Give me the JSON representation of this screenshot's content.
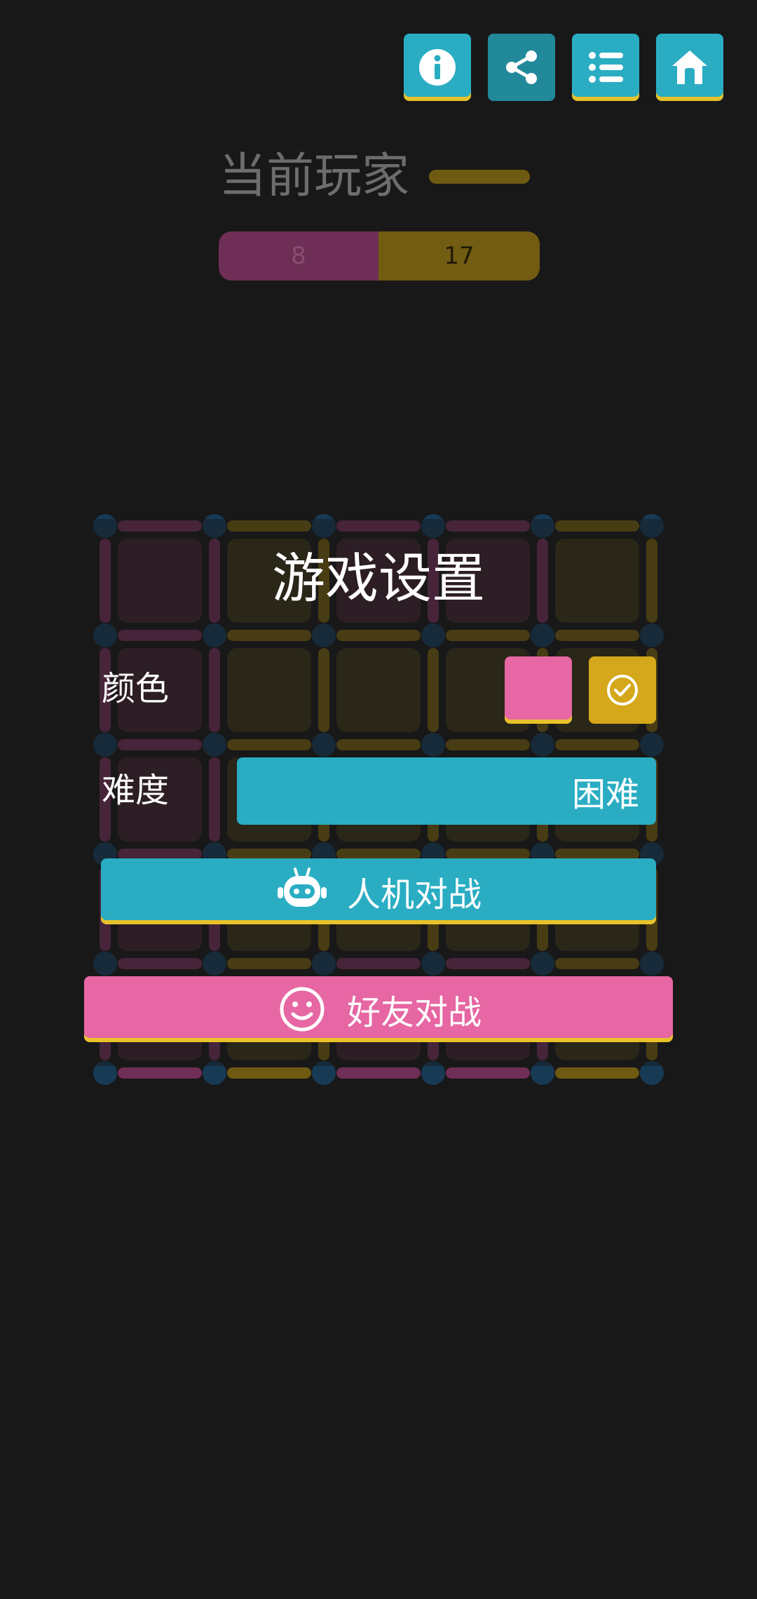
{
  "toolbar": {
    "buttons": [
      {
        "icon": "info-icon"
      },
      {
        "icon": "share-icon"
      },
      {
        "icon": "list-icon"
      },
      {
        "icon": "home-icon"
      }
    ]
  },
  "status": {
    "current_player_label": "当前玩家",
    "current_player_color": "#6f5a12",
    "score_pink": "8",
    "score_yellow": "17"
  },
  "board": {
    "cols": 5,
    "rows": 5,
    "cells": [
      [
        "pink",
        "yellow",
        "pink",
        "pink",
        "yellow"
      ],
      [
        "pink",
        "yellow",
        "yellow",
        "yellow",
        "yellow"
      ],
      [
        "pink",
        "yellow",
        "yellow",
        "yellow",
        "yellow"
      ],
      [
        "pink",
        "yellow",
        "yellow",
        "yellow",
        "yellow"
      ],
      [
        "pink",
        "yellow",
        "pink",
        "pink",
        "yellow"
      ]
    ],
    "colors": {
      "pink_cell": "#3f2330",
      "yellow_cell": "#3a3218",
      "pink_line": "#6e2e55",
      "yellow_line": "#6f5a12",
      "dot": "#173a55"
    }
  },
  "dialog": {
    "title": "游戏设置",
    "color_label": "颜色",
    "difficulty_label": "难度",
    "difficulty_value": "困难",
    "vs_ai_label": "人机对战",
    "vs_friend_label": "好友对战",
    "selected_color": "yellow",
    "pink": "#e667a3",
    "yellow": "#d4a81a",
    "accent": "#2aadc3"
  }
}
